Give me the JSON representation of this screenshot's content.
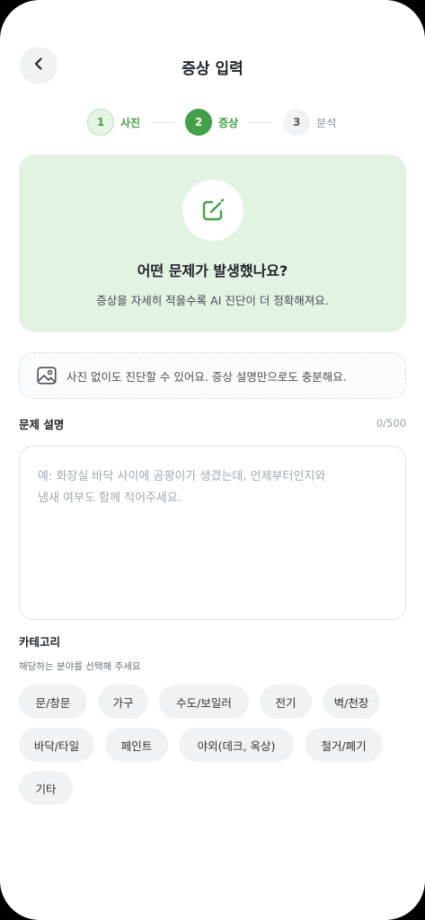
{
  "header": {
    "title": "증상 입력",
    "back_icon": "chevron-left-icon"
  },
  "stepper": {
    "steps": [
      {
        "number": "1",
        "label": "사진",
        "state": "done"
      },
      {
        "number": "2",
        "label": "증상",
        "state": "active"
      },
      {
        "number": "3",
        "label": "분석",
        "state": "todo"
      }
    ]
  },
  "hero": {
    "icon": "edit-icon",
    "title": "어떤 문제가 발생했나요?",
    "subtitle": "증상을 자세히 적을수록 AI 진단이 더 정확해져요."
  },
  "notice": {
    "icon": "image-icon",
    "text": "사진 없이도 진단할 수 있어요. 증상 설명만으로도 충분해요."
  },
  "description": {
    "label": "문제 설명",
    "counter": "0/500",
    "placeholder": "예: 화장실 바닥 사이에 곰팡이가 생겼는데, 언제부터인지와\n냄새 여부도 함께 적어주세요."
  },
  "category": {
    "title": "카테고리",
    "subtitle": "해당하는 분야를 선택해 주세요",
    "chips": [
      "문/창문",
      "가구",
      "수도/보일러",
      "전기",
      "벽/천장",
      "바닥/타일",
      "페인트",
      "야외(데크, 옥상)",
      "철거/폐기",
      "기타"
    ]
  },
  "colors": {
    "accent": "#43a047",
    "hero_bg": "#e3f3e2",
    "chip_bg": "#f1f2f4"
  }
}
